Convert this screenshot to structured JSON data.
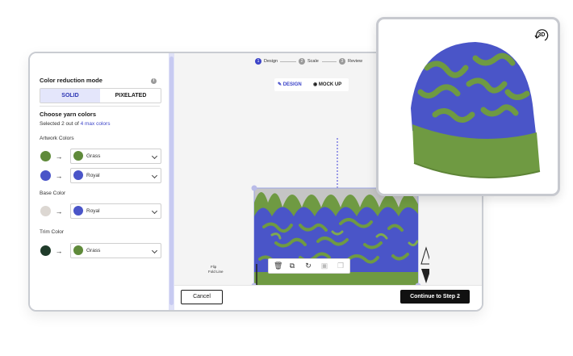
{
  "left_panel": {
    "mode_title": "Color reduction mode",
    "mode_options": [
      "SOLID",
      "PIXELATED"
    ],
    "yarn_title": "Choose yarn colors",
    "yarn_subtitle_prefix": "Selected 2 out of ",
    "yarn_subtitle_link": "4 max colors",
    "artwork_title": "Artwork Colors",
    "artwork_rows": [
      {
        "from_color": "#5f8a3a",
        "to_color": "#5f8a3a",
        "to_label": "Grass"
      },
      {
        "from_color": "#4a55c8",
        "to_color": "#4a55c8",
        "to_label": "Royal"
      }
    ],
    "base_title": "Base Color",
    "base_row": {
      "from_color": "#dcd7d2",
      "to_color": "#4a55c8",
      "to_label": "Royal"
    },
    "trim_title": "Trim Color",
    "trim_row": {
      "from_color": "#1f3b2a",
      "to_color": "#5f8a3a",
      "to_label": "Grass"
    }
  },
  "steps": [
    {
      "num": "1",
      "label": "Design",
      "active": true
    },
    {
      "num": "2",
      "label": "Scale",
      "active": false
    },
    {
      "num": "3",
      "label": "Review",
      "active": false
    }
  ],
  "view_toggle": {
    "design": "DESIGN",
    "mockup": "MOCK UP"
  },
  "canvas": {
    "flip_label": "Flip",
    "fold_label": "Fold Line"
  },
  "buttons": {
    "cancel": "Cancel",
    "next": "Continue to Step 2"
  },
  "preview": {
    "badge": "3D"
  },
  "colors": {
    "royal": "#4a55c8",
    "grass": "#6f9a42",
    "active_step": "#3c44c8"
  }
}
